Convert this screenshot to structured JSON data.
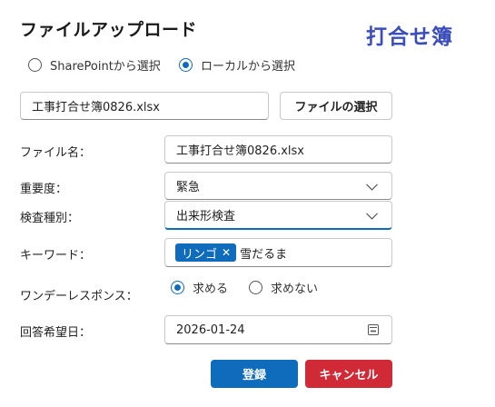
{
  "header": {
    "title": "ファイルアップロード",
    "brand": "打合せ簿"
  },
  "source_options": [
    {
      "label": "SharePointから選択",
      "selected": false
    },
    {
      "label": "ローカルから選択",
      "selected": true
    }
  ],
  "file_picker": {
    "file_value": "工事打合せ簿0826.xlsx",
    "choose_button": "ファイルの選択"
  },
  "form": {
    "file_name": {
      "label": "ファイル名：",
      "value": "工事打合せ簿0826.xlsx"
    },
    "importance": {
      "label": "重要度：",
      "value": "緊急"
    },
    "inspection_type": {
      "label": "検査種別：",
      "value": "出来形検査"
    },
    "keywords": {
      "label": "キーワード：",
      "tags": [
        "リンゴ"
      ],
      "input_value": "雪だるま"
    },
    "response": {
      "label": "ワンデーレスポンス：",
      "options": [
        {
          "label": "求める",
          "selected": true
        },
        {
          "label": "求めない",
          "selected": false
        }
      ]
    },
    "due_date": {
      "label": "回答希望日：",
      "value": "2026-01-24"
    }
  },
  "actions": {
    "register": "登録",
    "cancel": "キャンセル"
  },
  "colors": {
    "accent": "#0f6cbd",
    "brand": "#3a4dbb",
    "danger": "#cf2a36"
  }
}
